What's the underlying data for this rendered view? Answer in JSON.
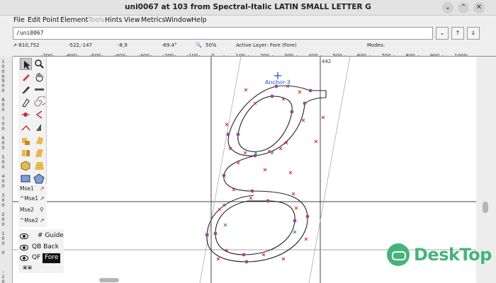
{
  "window": {
    "title": "uni0067 at 103 from Spectral-Italic LATIN SMALL LETTER G",
    "buttons": [
      "chevron-down",
      "chevron-up",
      "close"
    ]
  },
  "menubar": {
    "items": [
      "File",
      "Edit",
      "Point",
      "Element",
      "Tools",
      "Hints",
      "View",
      "Metrics",
      "Window",
      "Help"
    ],
    "disabled": [
      "Tools"
    ]
  },
  "name_field": {
    "value": "/uni0067"
  },
  "infobar": {
    "position": "-810,752",
    "value2": "-522,-147",
    "value3": "-8,9",
    "angle": "-69.4°",
    "zoom": "50%",
    "active_layer": "Active Layer: Fore (Fore)",
    "modes": "Modes:"
  },
  "ruler": {
    "h_labels": [
      "-700",
      "-600",
      "-500",
      "-400",
      "-300",
      "-200",
      "-100",
      "0",
      "100",
      "200",
      "300",
      "400",
      "500",
      "600",
      "700",
      "800",
      "900",
      "1000"
    ],
    "v_labels": [
      "1000",
      "900",
      "800",
      "700",
      "600",
      "500",
      "400",
      "300",
      "200",
      "100",
      "0",
      "-100"
    ]
  },
  "canvas": {
    "advance_label": "442",
    "anchor_label": "Anchor-3"
  },
  "mouse_info": {
    "mse1": "Mse1",
    "cmse1": "^Mse1",
    "mse2": "Mse2",
    "cmse2": "^Mse2"
  },
  "layers": {
    "guide": "# Guide",
    "back": "QB Back",
    "fore_prefix": "QF",
    "fore": "Fore"
  },
  "watermark": {
    "text": "DeskTop"
  },
  "icons": [
    "pointer-icon",
    "magnify-icon",
    "pencil-icon",
    "hand-icon",
    "knife-icon",
    "ruler-icon",
    "pen-icon",
    "spiro-icon",
    "curve-point-icon",
    "hvcurve-icon",
    "corner-point-icon",
    "tangent-point-icon",
    "scale-icon",
    "rotate-icon",
    "flip-icon",
    "skew-icon",
    "3d-rotate-icon",
    "perspective-icon",
    "rectangle-icon",
    "polygon-icon"
  ]
}
